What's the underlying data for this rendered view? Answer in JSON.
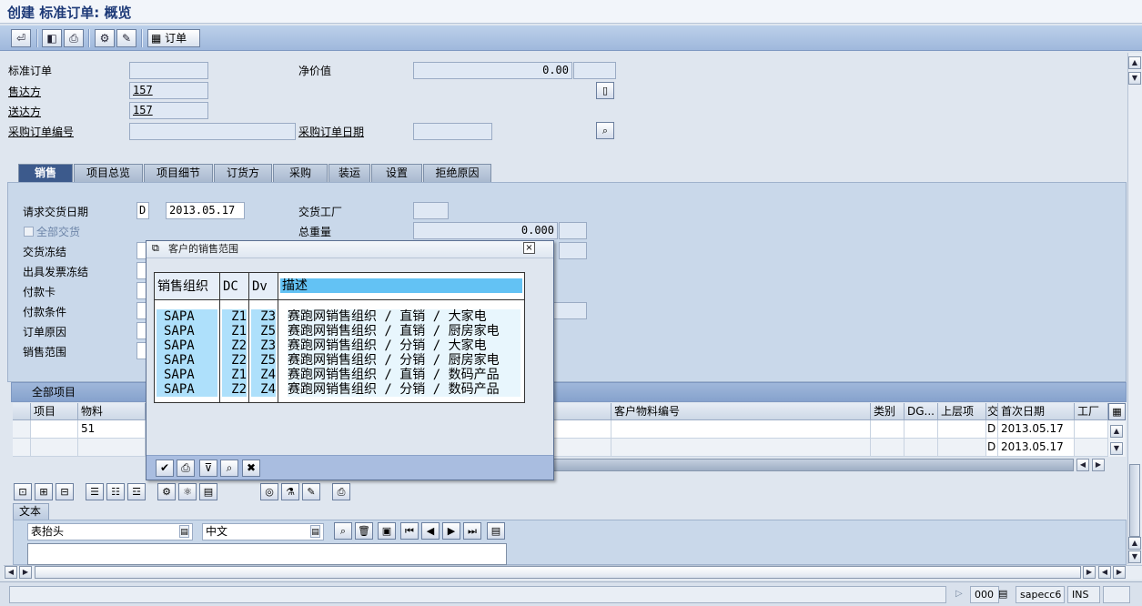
{
  "window": {
    "title": "创建 标准订单: 概览"
  },
  "toolbar": {
    "order_label": "订单"
  },
  "header": {
    "std_order_label": "标准订单",
    "std_order_value": "",
    "net_value_label": "净价值",
    "net_value": "0.00",
    "currency": "",
    "sold_to_label": "售达方",
    "sold_to_value": "157",
    "ship_to_label": "送达方",
    "ship_to_value": "157",
    "po_number_label": "采购订单编号",
    "po_number_value": "",
    "po_date_label": "采购订单日期",
    "po_date_value": ""
  },
  "tabs": [
    "销售",
    "项目总览",
    "项目细节",
    "订货方",
    "采购",
    "装运",
    "设置",
    "拒绝原因"
  ],
  "sales": {
    "req_delivery_label": "请求交货日期",
    "req_delivery_type": "D",
    "req_delivery_date": "2013.05.17",
    "full_delivery_label": "全部交货",
    "delivery_block_label": "交货冻结",
    "billing_block_label": "出具发票冻结",
    "payment_card_label": "付款卡",
    "payment_terms_label": "付款条件",
    "order_reason_label": "订单原因",
    "sales_area_label": "销售范围",
    "delivering_plant_label": "交货工厂",
    "total_weight_label": "总重量",
    "total_weight_value": "0.000"
  },
  "items": {
    "section_title": "全部项目",
    "columns": {
      "item": "项目",
      "material": "物料",
      "cust_material": "客户物料编号",
      "category": "类别",
      "dg": "DG...",
      "higher_item": "上层项",
      "del": "交",
      "first_date": "首次日期",
      "plant": "工厂"
    },
    "rows": [
      {
        "item": "",
        "material": "51",
        "cust_material": "",
        "category": "",
        "dg": "",
        "higher_item": "",
        "del": "D",
        "first_date": "2013.05.17",
        "plant": ""
      },
      {
        "item": "",
        "material": "",
        "cust_material": "",
        "category": "",
        "dg": "",
        "higher_item": "",
        "del": "D",
        "first_date": "2013.05.17",
        "plant": ""
      }
    ]
  },
  "text_area": {
    "tab_label": "文本",
    "text_type": "表抬头",
    "language": "中文",
    "content": ""
  },
  "dialog": {
    "title": "客户的销售范围",
    "headers": {
      "sales_org": "销售组织",
      "dc": "DC",
      "dv": "Dv",
      "desc": "描述"
    },
    "rows": [
      {
        "org": "SAPA",
        "dc": "Z1",
        "dv": "Z3",
        "desc": "赛跑网销售组织 / 直销 / 大家电"
      },
      {
        "org": "SAPA",
        "dc": "Z1",
        "dv": "Z5",
        "desc": "赛跑网销售组织 / 直销 / 厨房家电"
      },
      {
        "org": "SAPA",
        "dc": "Z2",
        "dv": "Z3",
        "desc": "赛跑网销售组织 / 分销 / 大家电"
      },
      {
        "org": "SAPA",
        "dc": "Z2",
        "dv": "Z5",
        "desc": "赛跑网销售组织 / 分销 / 厨房家电"
      },
      {
        "org": "SAPA",
        "dc": "Z1",
        "dv": "Z4",
        "desc": "赛跑网销售组织 / 直销 / 数码产品"
      },
      {
        "org": "SAPA",
        "dc": "Z2",
        "dv": "Z4",
        "desc": "赛跑网销售组织 / 分销 / 数码产品"
      }
    ]
  },
  "statusbar": {
    "session": "000",
    "server": "sapecc6",
    "mode": "INS"
  },
  "icons": [
    "enter-icon",
    "back-icon",
    "print-icon",
    "find-icon",
    "edit-icon",
    "grid-icon",
    "document-icon",
    "lookup-icon",
    "check-icon",
    "filter-icon",
    "binoculars-icon",
    "cancel-icon"
  ]
}
